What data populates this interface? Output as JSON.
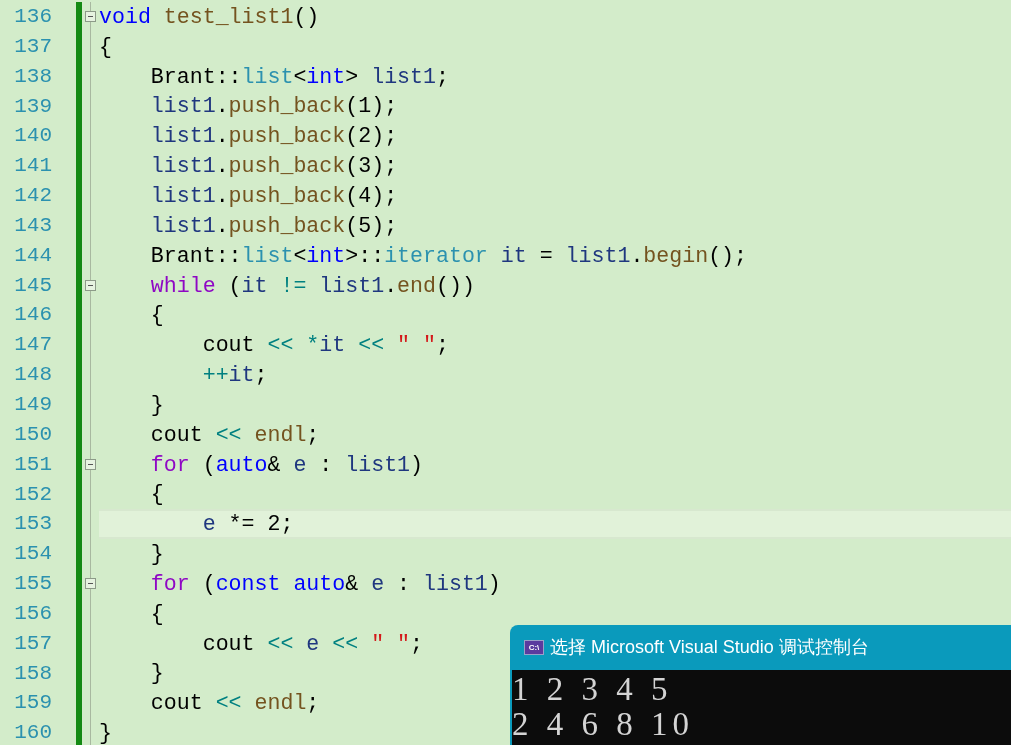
{
  "editor": {
    "lines": [
      {
        "number": "136",
        "fold_marker": true,
        "current": false,
        "tokens": [
          {
            "kind": "kw",
            "text": "void"
          },
          {
            "kind": "func",
            "text": " test_list1"
          },
          {
            "kind": "plain",
            "text": "()"
          }
        ]
      },
      {
        "number": "137",
        "fold_marker": false,
        "current": false,
        "tokens": [
          {
            "kind": "plain",
            "text": "{"
          }
        ]
      },
      {
        "number": "138",
        "fold_marker": false,
        "current": false,
        "tokens": [
          {
            "kind": "plain",
            "text": "    Brant::"
          },
          {
            "kind": "type",
            "text": "list"
          },
          {
            "kind": "plain",
            "text": "<"
          },
          {
            "kind": "kw",
            "text": "int"
          },
          {
            "kind": "plain",
            "text": ">"
          },
          {
            "kind": "var",
            "text": " list1"
          },
          {
            "kind": "plain",
            "text": ";"
          }
        ]
      },
      {
        "number": "139",
        "fold_marker": false,
        "current": false,
        "tokens": [
          {
            "kind": "var",
            "text": "    list1"
          },
          {
            "kind": "plain",
            "text": "."
          },
          {
            "kind": "func",
            "text": "push_back"
          },
          {
            "kind": "plain",
            "text": "(1);"
          }
        ]
      },
      {
        "number": "140",
        "fold_marker": false,
        "current": false,
        "tokens": [
          {
            "kind": "var",
            "text": "    list1"
          },
          {
            "kind": "plain",
            "text": "."
          },
          {
            "kind": "func",
            "text": "push_back"
          },
          {
            "kind": "plain",
            "text": "(2);"
          }
        ]
      },
      {
        "number": "141",
        "fold_marker": false,
        "current": false,
        "tokens": [
          {
            "kind": "var",
            "text": "    list1"
          },
          {
            "kind": "plain",
            "text": "."
          },
          {
            "kind": "func",
            "text": "push_back"
          },
          {
            "kind": "plain",
            "text": "(3);"
          }
        ]
      },
      {
        "number": "142",
        "fold_marker": false,
        "current": false,
        "tokens": [
          {
            "kind": "var",
            "text": "    list1"
          },
          {
            "kind": "plain",
            "text": "."
          },
          {
            "kind": "func",
            "text": "push_back"
          },
          {
            "kind": "plain",
            "text": "(4);"
          }
        ]
      },
      {
        "number": "143",
        "fold_marker": false,
        "current": false,
        "tokens": [
          {
            "kind": "var",
            "text": "    list1"
          },
          {
            "kind": "plain",
            "text": "."
          },
          {
            "kind": "func",
            "text": "push_back"
          },
          {
            "kind": "plain",
            "text": "(5);"
          }
        ]
      },
      {
        "number": "144",
        "fold_marker": false,
        "current": false,
        "tokens": [
          {
            "kind": "plain",
            "text": "    Brant::"
          },
          {
            "kind": "type",
            "text": "list"
          },
          {
            "kind": "plain",
            "text": "<"
          },
          {
            "kind": "kw",
            "text": "int"
          },
          {
            "kind": "plain",
            "text": ">::"
          },
          {
            "kind": "type",
            "text": "iterator"
          },
          {
            "kind": "var",
            "text": " it"
          },
          {
            "kind": "plain",
            "text": " ="
          },
          {
            "kind": "var",
            "text": " list1"
          },
          {
            "kind": "plain",
            "text": "."
          },
          {
            "kind": "func",
            "text": "begin"
          },
          {
            "kind": "plain",
            "text": "();"
          }
        ]
      },
      {
        "number": "145",
        "fold_marker": true,
        "current": false,
        "tokens": [
          {
            "kind": "ctl",
            "text": "    while"
          },
          {
            "kind": "plain",
            "text": " ("
          },
          {
            "kind": "var",
            "text": "it"
          },
          {
            "kind": "op",
            "text": " !="
          },
          {
            "kind": "var",
            "text": " list1"
          },
          {
            "kind": "plain",
            "text": "."
          },
          {
            "kind": "func",
            "text": "end"
          },
          {
            "kind": "plain",
            "text": "())"
          }
        ]
      },
      {
        "number": "146",
        "fold_marker": false,
        "current": false,
        "tokens": [
          {
            "kind": "plain",
            "text": "    {"
          }
        ]
      },
      {
        "number": "147",
        "fold_marker": false,
        "current": false,
        "tokens": [
          {
            "kind": "plain",
            "text": "        cout"
          },
          {
            "kind": "op",
            "text": " <<"
          },
          {
            "kind": "op",
            "text": " *"
          },
          {
            "kind": "var",
            "text": "it"
          },
          {
            "kind": "op",
            "text": " <<"
          },
          {
            "kind": "str",
            "text": " \" \""
          },
          {
            "kind": "plain",
            "text": ";"
          }
        ]
      },
      {
        "number": "148",
        "fold_marker": false,
        "current": false,
        "tokens": [
          {
            "kind": "op",
            "text": "        ++"
          },
          {
            "kind": "var",
            "text": "it"
          },
          {
            "kind": "plain",
            "text": ";"
          }
        ]
      },
      {
        "number": "149",
        "fold_marker": false,
        "current": false,
        "tokens": [
          {
            "kind": "plain",
            "text": "    }"
          }
        ]
      },
      {
        "number": "150",
        "fold_marker": false,
        "current": false,
        "tokens": [
          {
            "kind": "plain",
            "text": "    cout"
          },
          {
            "kind": "op",
            "text": " <<"
          },
          {
            "kind": "func",
            "text": " endl"
          },
          {
            "kind": "plain",
            "text": ";"
          }
        ]
      },
      {
        "number": "151",
        "fold_marker": true,
        "current": false,
        "tokens": [
          {
            "kind": "ctl",
            "text": "    for"
          },
          {
            "kind": "plain",
            "text": " ("
          },
          {
            "kind": "kw",
            "text": "auto"
          },
          {
            "kind": "plain",
            "text": "&"
          },
          {
            "kind": "var",
            "text": " e"
          },
          {
            "kind": "plain",
            "text": " :"
          },
          {
            "kind": "var",
            "text": " list1"
          },
          {
            "kind": "plain",
            "text": ")"
          }
        ]
      },
      {
        "number": "152",
        "fold_marker": false,
        "current": false,
        "tokens": [
          {
            "kind": "plain",
            "text": "    {"
          }
        ]
      },
      {
        "number": "153",
        "fold_marker": false,
        "current": true,
        "tokens": [
          {
            "kind": "var",
            "text": "        e"
          },
          {
            "kind": "plain",
            "text": " *= 2;"
          }
        ]
      },
      {
        "number": "154",
        "fold_marker": false,
        "current": false,
        "tokens": [
          {
            "kind": "plain",
            "text": "    }"
          }
        ]
      },
      {
        "number": "155",
        "fold_marker": true,
        "current": false,
        "tokens": [
          {
            "kind": "ctl",
            "text": "    for"
          },
          {
            "kind": "plain",
            "text": " ("
          },
          {
            "kind": "kw",
            "text": "const"
          },
          {
            "kind": "kw",
            "text": " auto"
          },
          {
            "kind": "plain",
            "text": "&"
          },
          {
            "kind": "var",
            "text": " e"
          },
          {
            "kind": "plain",
            "text": " :"
          },
          {
            "kind": "var",
            "text": " list1"
          },
          {
            "kind": "plain",
            "text": ")"
          }
        ]
      },
      {
        "number": "156",
        "fold_marker": false,
        "current": false,
        "tokens": [
          {
            "kind": "plain",
            "text": "    {"
          }
        ]
      },
      {
        "number": "157",
        "fold_marker": false,
        "current": false,
        "tokens": [
          {
            "kind": "plain",
            "text": "        cout"
          },
          {
            "kind": "op",
            "text": " <<"
          },
          {
            "kind": "var",
            "text": " e"
          },
          {
            "kind": "op",
            "text": " <<"
          },
          {
            "kind": "str",
            "text": " \" \""
          },
          {
            "kind": "plain",
            "text": ";"
          }
        ]
      },
      {
        "number": "158",
        "fold_marker": false,
        "current": false,
        "tokens": [
          {
            "kind": "plain",
            "text": "    }"
          }
        ]
      },
      {
        "number": "159",
        "fold_marker": false,
        "current": false,
        "tokens": [
          {
            "kind": "plain",
            "text": "    cout"
          },
          {
            "kind": "op",
            "text": " <<"
          },
          {
            "kind": "func",
            "text": " endl"
          },
          {
            "kind": "plain",
            "text": ";"
          }
        ]
      },
      {
        "number": "160",
        "fold_marker": false,
        "current": false,
        "tokens": [
          {
            "kind": "plain",
            "text": "}"
          }
        ]
      }
    ]
  },
  "console": {
    "icon_text": "C:\\",
    "title": "选择 Microsoft Visual Studio 调试控制台",
    "output": [
      "1 2 3 4 5",
      "2 4 6 8 10"
    ]
  }
}
